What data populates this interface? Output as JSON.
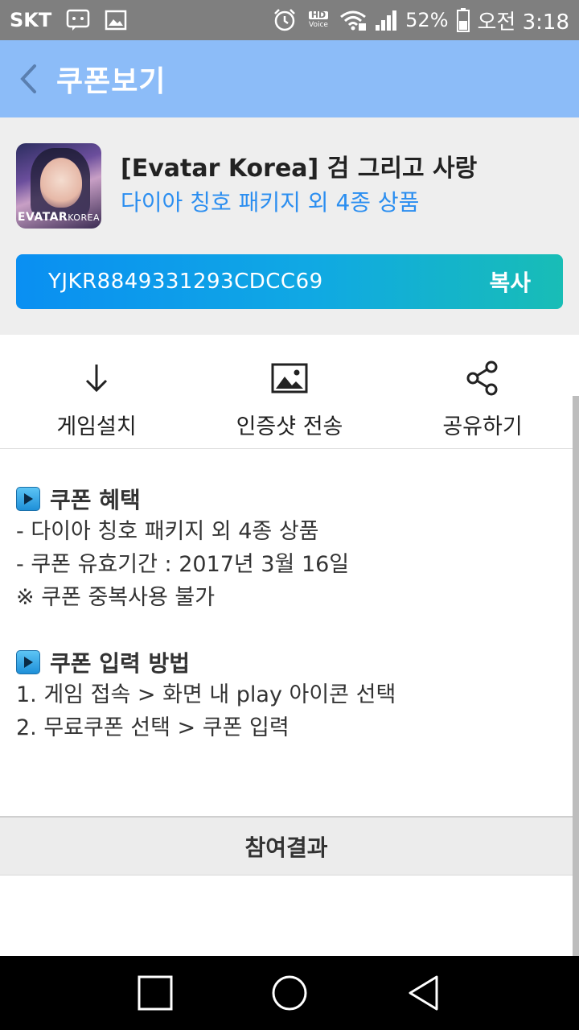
{
  "status_bar": {
    "carrier": "SKT",
    "hd_label": "HD",
    "voice_label": "Voice",
    "battery": "52%",
    "time": "오전 3:18"
  },
  "header": {
    "title": "쿠폰보기"
  },
  "coupon": {
    "thumb_label_main": "EVATAR",
    "thumb_label_sub": "KOREA",
    "game_title": "[Evatar Korea] 검 그리고 사랑",
    "game_subtitle": "다이아 칭호 패키지 외 4종 상품",
    "code": "YJKR8849331293CDCC69",
    "copy_label": "복사"
  },
  "actions": [
    {
      "label": "게임설치",
      "icon": "download-icon"
    },
    {
      "label": "인증샷 전송",
      "icon": "image-icon"
    },
    {
      "label": "공유하기",
      "icon": "share-icon"
    }
  ],
  "benefits": {
    "heading": "쿠폰 혜택",
    "lines": [
      "- 다이아 칭호 패키지 외 4종 상품",
      "- 쿠폰 유효기간 : 2017년 3월 16일",
      "※ 쿠폰 중복사용 불가"
    ]
  },
  "howto": {
    "heading": "쿠폰 입력 방법",
    "lines": [
      "1. 게임 접속 > 화면 내 play 아이콘 선택",
      "2. 무료쿠폰 선택 > 쿠폰 입력"
    ]
  },
  "result_button": "참여결과",
  "colors": {
    "header_bg": "#8cbcf8",
    "accent_blue": "#2b8ef0",
    "code_gradient_start": "#0a8ff2",
    "code_gradient_end": "#18bdb6"
  }
}
